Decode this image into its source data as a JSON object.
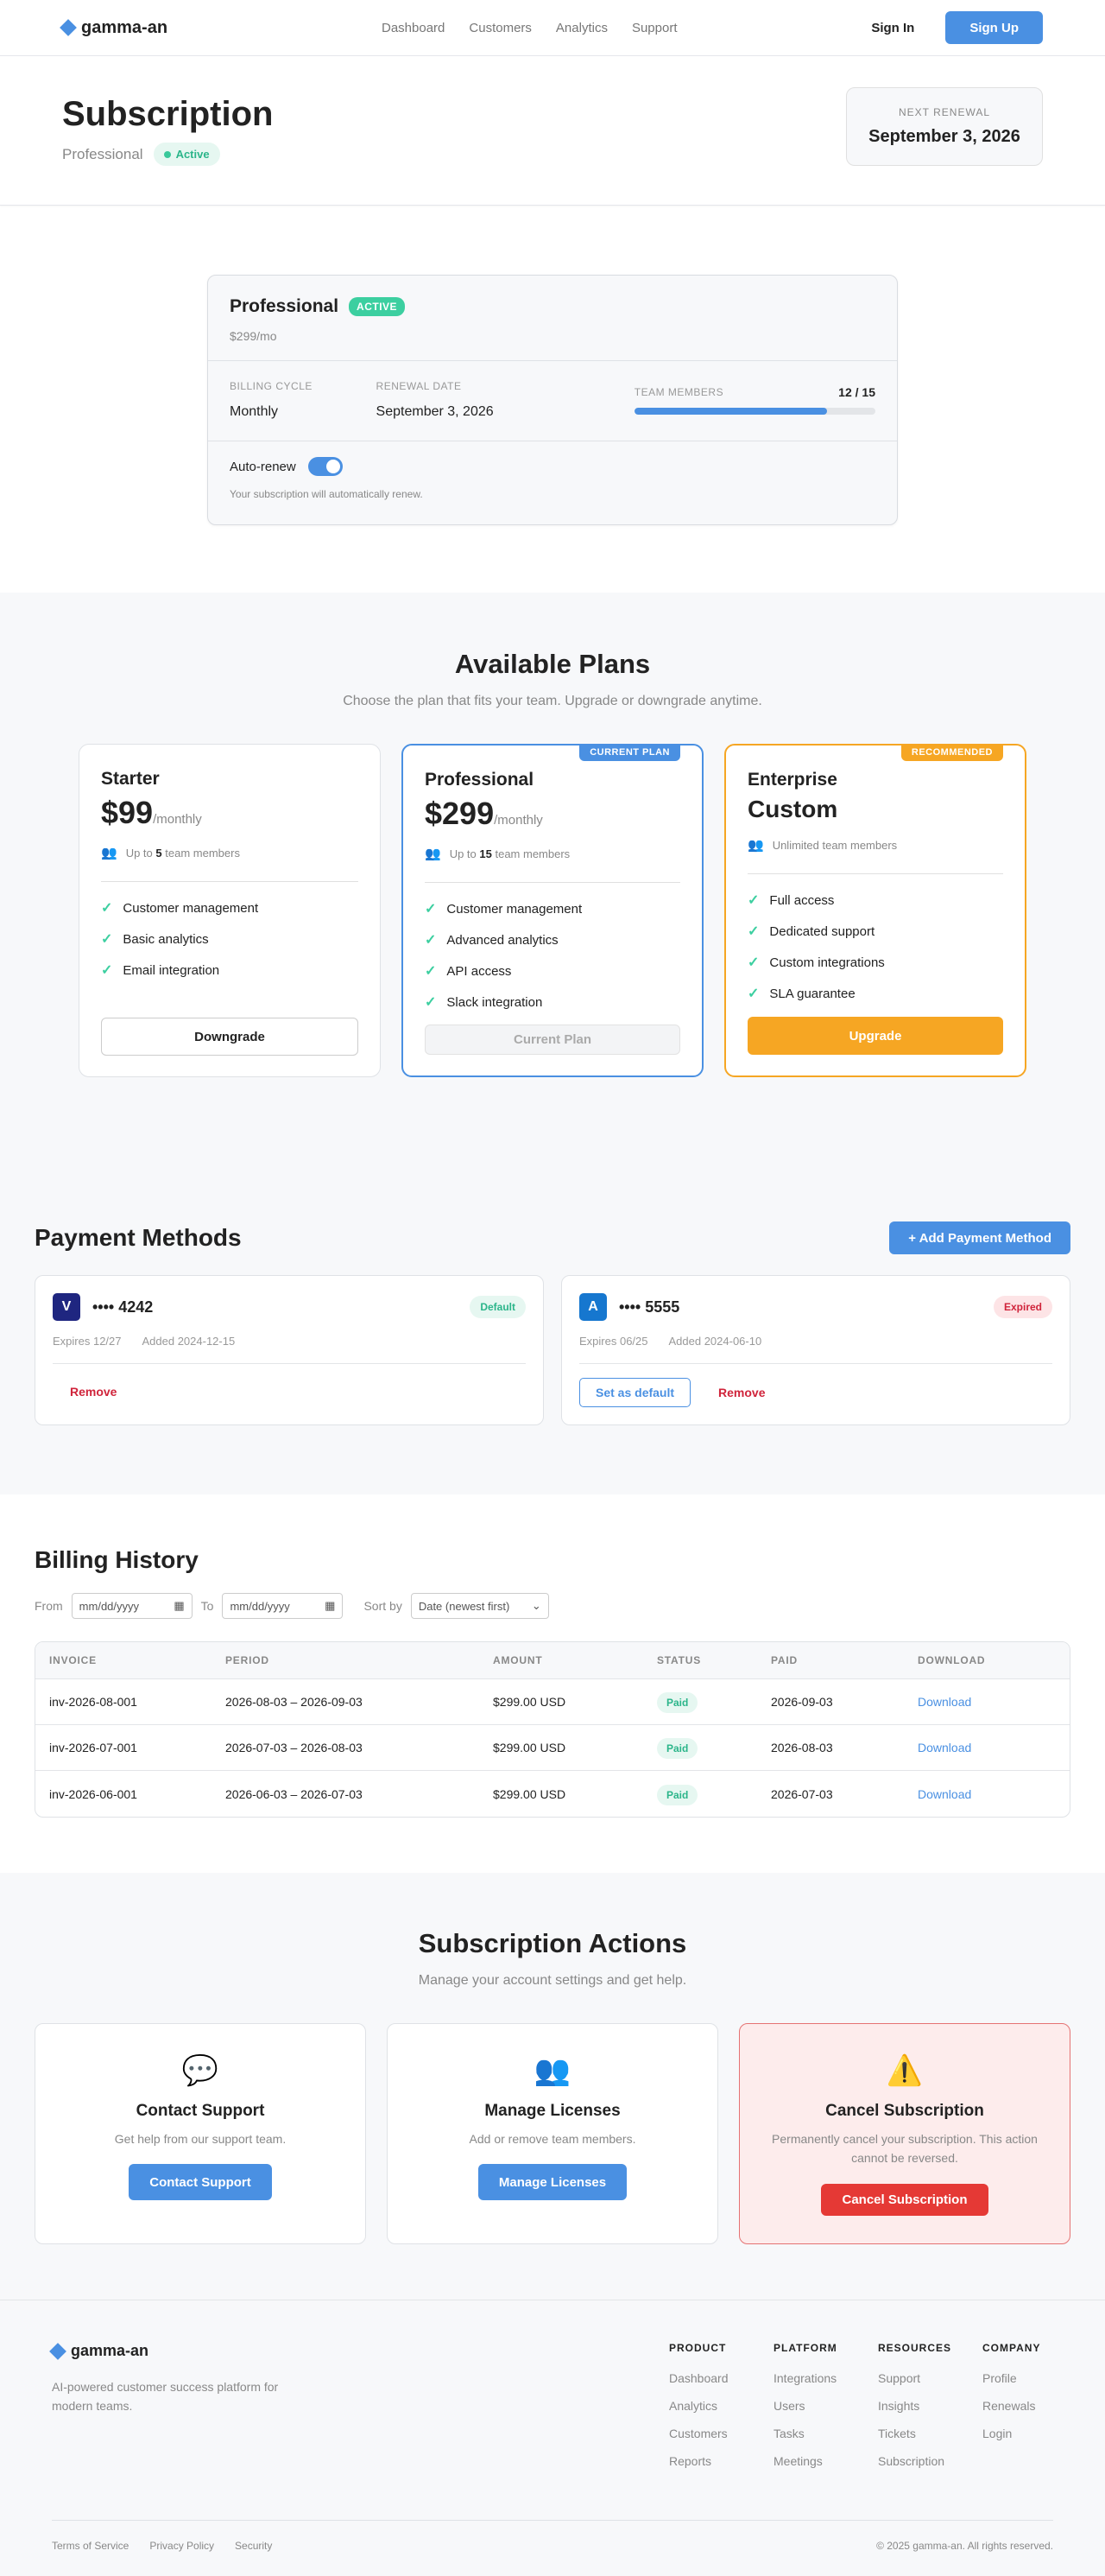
{
  "nav": {
    "brand": "gamma-an",
    "links": [
      "Dashboard",
      "Customers",
      "Analytics",
      "Support"
    ],
    "signin": "Sign In",
    "signup": "Sign Up"
  },
  "hero": {
    "title": "Subscription",
    "plan": "Professional",
    "status": "Active",
    "renewal_label": "NEXT RENEWAL",
    "renewal_date": "September 3, 2026"
  },
  "summary": {
    "plan": "Professional",
    "badge": "ACTIVE",
    "price": "$299/mo",
    "billing_label": "BILLING CYCLE",
    "billing_value": "Monthly",
    "renewal_label": "RENEWAL DATE",
    "renewal_value": "September 3, 2026",
    "team_label": "TEAM MEMBERS",
    "team_count": "12 / 15",
    "team_fraction": 0.8,
    "autorenew_label": "Auto-renew",
    "autorenew_note": "Your subscription will automatically renew."
  },
  "plans": {
    "title": "Available Plans",
    "subtitle": "Choose the plan that fits your team. Upgrade or downgrade anytime.",
    "starter": {
      "name": "Starter",
      "price": "$99",
      "per": "/monthly",
      "members_pre": "Up to",
      "members_num": "5",
      "members_post": "team members",
      "features": [
        "Customer management",
        "Basic analytics",
        "Email integration"
      ],
      "button": "Downgrade"
    },
    "pro": {
      "flag": "CURRENT PLAN",
      "name": "Professional",
      "price": "$299",
      "per": "/monthly",
      "members_pre": "Up to",
      "members_num": "15",
      "members_post": "team members",
      "features": [
        "Customer management",
        "Advanced analytics",
        "API access",
        "Slack integration"
      ],
      "button": "Current Plan"
    },
    "ent": {
      "flag": "RECOMMENDED",
      "name": "Enterprise",
      "price": "Custom",
      "members": "Unlimited team members",
      "features": [
        "Full access",
        "Dedicated support",
        "Custom integrations",
        "SLA guarantee"
      ],
      "button": "Upgrade"
    }
  },
  "payment": {
    "title": "Payment Methods",
    "add": "+ Add Payment Method",
    "cards": [
      {
        "logo": "V",
        "number": "•••• 4242",
        "badge": "Default",
        "expires": "Expires 12/27",
        "added": "Added 2024-12-15",
        "remove": "Remove"
      },
      {
        "logo": "A",
        "number": "•••• 5555",
        "badge": "Expired",
        "expires": "Expires 06/25",
        "added": "Added 2024-06-10",
        "set_default": "Set as default",
        "remove": "Remove"
      }
    ]
  },
  "billing": {
    "title": "Billing History",
    "from": "From",
    "to": "To",
    "date_placeholder": "mm/dd/yyyy",
    "sort_label": "Sort by",
    "sort_value": "Date (newest first)",
    "headers": [
      "INVOICE",
      "PERIOD",
      "AMOUNT",
      "STATUS",
      "PAID",
      "DOWNLOAD"
    ],
    "rows": [
      {
        "invoice": "inv-2026-08-001",
        "period": "2026-08-03 – 2026-09-03",
        "amount": "$299.00 USD",
        "status": "Paid",
        "paid": "2026-09-03",
        "download": "Download"
      },
      {
        "invoice": "inv-2026-07-001",
        "period": "2026-07-03 – 2026-08-03",
        "amount": "$299.00 USD",
        "status": "Paid",
        "paid": "2026-08-03",
        "download": "Download"
      },
      {
        "invoice": "inv-2026-06-001",
        "period": "2026-06-03 – 2026-07-03",
        "amount": "$299.00 USD",
        "status": "Paid",
        "paid": "2026-07-03",
        "download": "Download"
      }
    ]
  },
  "actions": {
    "title": "Subscription Actions",
    "subtitle": "Manage your account settings and get help.",
    "support": {
      "icon": "💬",
      "title": "Contact Support",
      "desc": "Get help from our support team.",
      "button": "Contact Support"
    },
    "licenses": {
      "icon": "👥",
      "title": "Manage Licenses",
      "desc": "Add or remove team members.",
      "button": "Manage Licenses"
    },
    "cancel": {
      "icon": "⚠️",
      "title": "Cancel Subscription",
      "desc": "Permanently cancel your subscription. This action cannot be reversed.",
      "button": "Cancel Subscription"
    }
  },
  "footer": {
    "brand": "gamma-an",
    "tagline": "AI-powered customer success platform for modern teams.",
    "columns": [
      {
        "title": "PRODUCT",
        "items": [
          "Dashboard",
          "Analytics",
          "Customers",
          "Reports"
        ]
      },
      {
        "title": "PLATFORM",
        "items": [
          "Integrations",
          "Users",
          "Tasks",
          "Meetings"
        ]
      },
      {
        "title": "RESOURCES",
        "items": [
          "Support",
          "Insights",
          "Tickets",
          "Subscription"
        ]
      },
      {
        "title": "COMPANY",
        "items": [
          "Profile",
          "Renewals",
          "Login"
        ]
      }
    ],
    "legal": [
      "Terms of Service",
      "Privacy Policy",
      "Security"
    ],
    "copyright": "© 2025 gamma-an. All rights reserved."
  },
  "colors": {
    "accent": "#4a90e2",
    "success": "#3ccfa0",
    "warning": "#f6a623",
    "danger": "#e53935"
  }
}
